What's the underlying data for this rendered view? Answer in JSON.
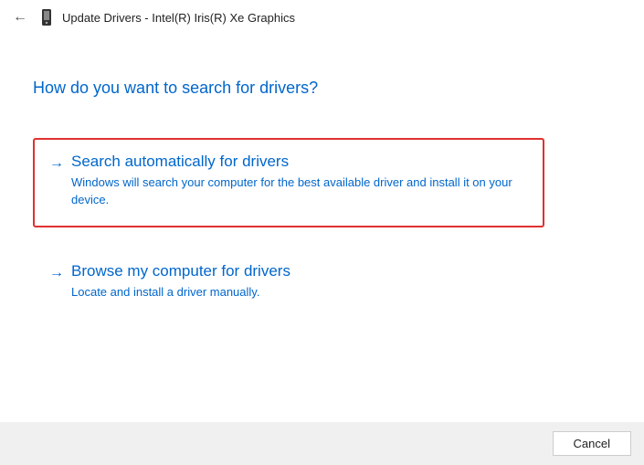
{
  "header": {
    "title": "Update Drivers - Intel(R) Iris(R) Xe Graphics"
  },
  "main": {
    "question": "How do you want to search for drivers?",
    "options": [
      {
        "title": "Search automatically for drivers",
        "description": "Windows will search your computer for the best available driver and install it on your device.",
        "highlighted": true
      },
      {
        "title": "Browse my computer for drivers",
        "description": "Locate and install a driver manually.",
        "highlighted": false
      }
    ]
  },
  "footer": {
    "cancel_label": "Cancel"
  }
}
